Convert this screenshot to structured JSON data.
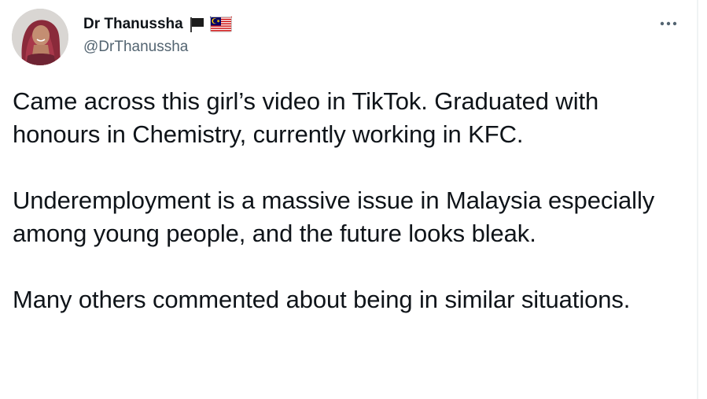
{
  "tweet": {
    "author": {
      "display_name": "Dr Thanussha",
      "handle": "@DrThanussha",
      "badges": [
        "black-flag-icon",
        "malaysia-flag-icon"
      ]
    },
    "more_icon": "more-horizontal-icon",
    "paragraphs": [
      "Came across this girl’s video in TikTok. Graduated with honours in Chemistry, currently working in KFC.",
      "Underemployment is a massive issue in Malaysia especially among young people, and the future looks bleak.",
      "Many others commented about being in similar situations."
    ]
  },
  "colors": {
    "text_primary": "#0f1419",
    "text_secondary": "#536471",
    "background": "#ffffff",
    "border": "#eff3f4"
  }
}
